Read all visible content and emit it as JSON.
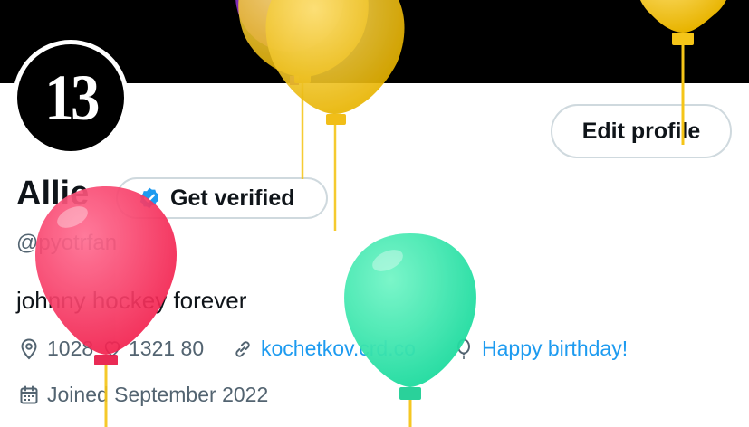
{
  "profile": {
    "avatar_text": "13",
    "name": "Allie",
    "verify_label": "Get verified",
    "handle": "@pyotrfan",
    "bio": "johnny hockey forever",
    "location": "1028",
    "link_text": "kochetkov.crd.co",
    "birthday": "Happy birthday!",
    "joined": "Joined September 2022"
  },
  "actions": {
    "edit_profile_label": "Edit profile"
  },
  "extra": {
    "numbers": "1321 80"
  },
  "colors": {
    "accent": "#1d9bf0",
    "secondary_text": "#536471",
    "balloon_gold": "#f5c518",
    "balloon_purple": "#8b2fc9",
    "balloon_red": "#f5336b",
    "balloon_green": "#2ee8a8"
  },
  "icons": {
    "location": "location-pin-icon",
    "link": "link-icon",
    "birthday": "balloon-icon",
    "calendar": "calendar-icon",
    "verified": "verified-badge-icon",
    "heart": "heart-outline-icon"
  }
}
